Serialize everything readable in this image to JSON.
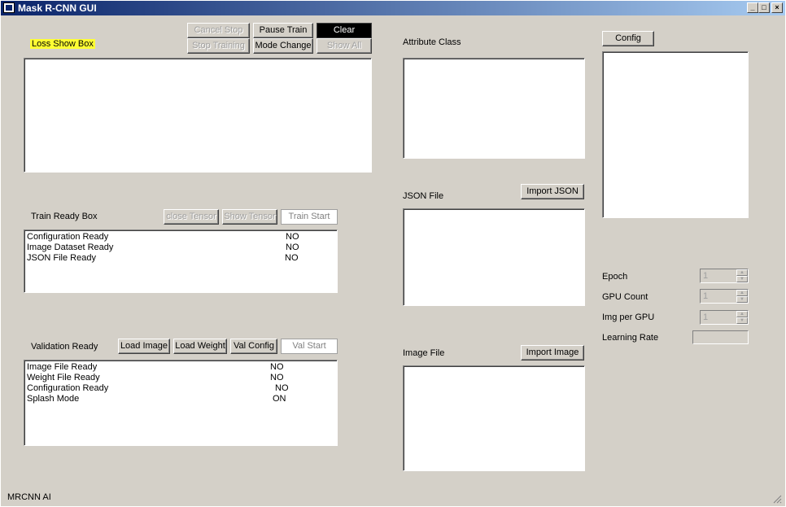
{
  "window": {
    "title": "Mask R-CNN GUI",
    "minimize": "_",
    "maximize": "□",
    "close": "×"
  },
  "loss": {
    "label": "Loss Show Box",
    "buttons": {
      "cancel_stop": "Cancel Stop",
      "pause_train": "Pause Train",
      "clear": "Clear",
      "stop_training": "Stop Training",
      "mode_change": "Mode Change",
      "show_all": "Show All"
    }
  },
  "train": {
    "label": "Train Ready Box",
    "buttons": {
      "close_tensor": "close Tensor",
      "show_tensor": "Show Tensor",
      "train_start": "Train Start"
    },
    "rows": [
      {
        "key": "Configuration Ready",
        "value": "NO"
      },
      {
        "key": "Image Dataset Ready",
        "value": "NO"
      },
      {
        "key": "JSON File Ready",
        "value": "NO"
      }
    ]
  },
  "validation": {
    "label": "Validation Ready",
    "buttons": {
      "load_image": "Load Image",
      "load_weight": "Load Weight",
      "val_config": "Val Config",
      "val_start": "Val Start"
    },
    "rows": [
      {
        "key": "Image File Ready",
        "value": "NO"
      },
      {
        "key": "Weight File Ready",
        "value": "NO"
      },
      {
        "key": "Configuration Ready",
        "value": "NO"
      },
      {
        "key": "Splash Mode",
        "value": "ON"
      }
    ]
  },
  "attribute": {
    "label": "Attribute Class"
  },
  "json_file": {
    "label": "JSON File",
    "import_button": "Import JSON"
  },
  "image_file": {
    "label": "Image File",
    "import_button": "Import Image"
  },
  "config": {
    "button": "Config",
    "epoch": {
      "label": "Epoch",
      "value": "1"
    },
    "gpu_count": {
      "label": "GPU Count",
      "value": "1"
    },
    "img_per_gpu": {
      "label": "Img per GPU",
      "value": "1"
    },
    "learning_rate": {
      "label": "Learning Rate",
      "value": ""
    }
  },
  "statusbar": {
    "text": "MRCNN AI"
  }
}
